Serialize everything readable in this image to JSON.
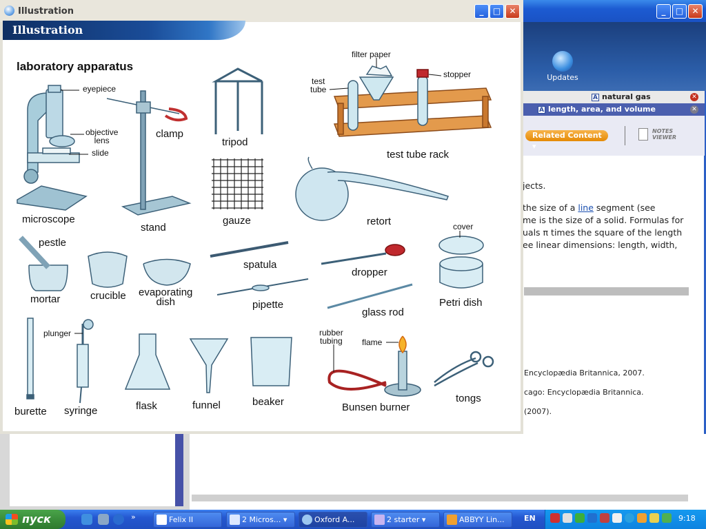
{
  "window": {
    "title": "Illustration",
    "banner": "Illustration",
    "heading": "laboratory apparatus"
  },
  "labels": {
    "eyepiece": "eyepiece",
    "objective_lens": "objective\nlens",
    "slide": "slide",
    "microscope": "microscope",
    "clamp": "clamp",
    "stand": "stand",
    "tripod": "tripod",
    "gauze": "gauze",
    "filter_paper": "filter paper",
    "test_tube": "test\ntube",
    "stopper": "stopper",
    "test_tube_rack": "test tube rack",
    "retort": "retort",
    "pestle": "pestle",
    "mortar": "mortar",
    "crucible": "crucible",
    "evaporating_dish": "evaporating\ndish",
    "spatula": "spatula",
    "pipette": "pipette",
    "dropper": "dropper",
    "glass_rod": "glass rod",
    "cover": "cover",
    "petri_dish": "Petri dish",
    "burette": "burette",
    "plunger": "plunger",
    "syringe": "syringe",
    "flask": "flask",
    "funnel": "funnel",
    "beaker": "beaker",
    "rubber_tubing": "rubber\ntubing",
    "flame": "flame",
    "bunsen_burner": "Bunsen burner",
    "tongs": "tongs"
  },
  "background_window": {
    "updates_label": "Updates",
    "tab1": "natural gas",
    "tab2": "length, area, and volume",
    "related_button": "Related Content",
    "notes_viewer": "NOTES\nVIEWER",
    "body": {
      "line1": "jects.",
      "line2_pre": "the size of a ",
      "line2_link": "line",
      "line2_post": " segment (see",
      "line3": "me is the size of a solid. Formulas for",
      "line4": "uals π times the square of the length",
      "line5": "ee linear dimensions: length, width,"
    },
    "citations": [
      "Encyclopædia Britannica, 2007.",
      "cago: Encyclopædia Britannica.",
      "(2007)."
    ]
  },
  "taskbar": {
    "start": "пуск",
    "tasks": [
      "Felix II",
      "2 Micros...",
      "Oxford A...",
      "2 starter",
      "ABBYY Lin..."
    ],
    "lang": "EN",
    "clock": "9:18"
  }
}
